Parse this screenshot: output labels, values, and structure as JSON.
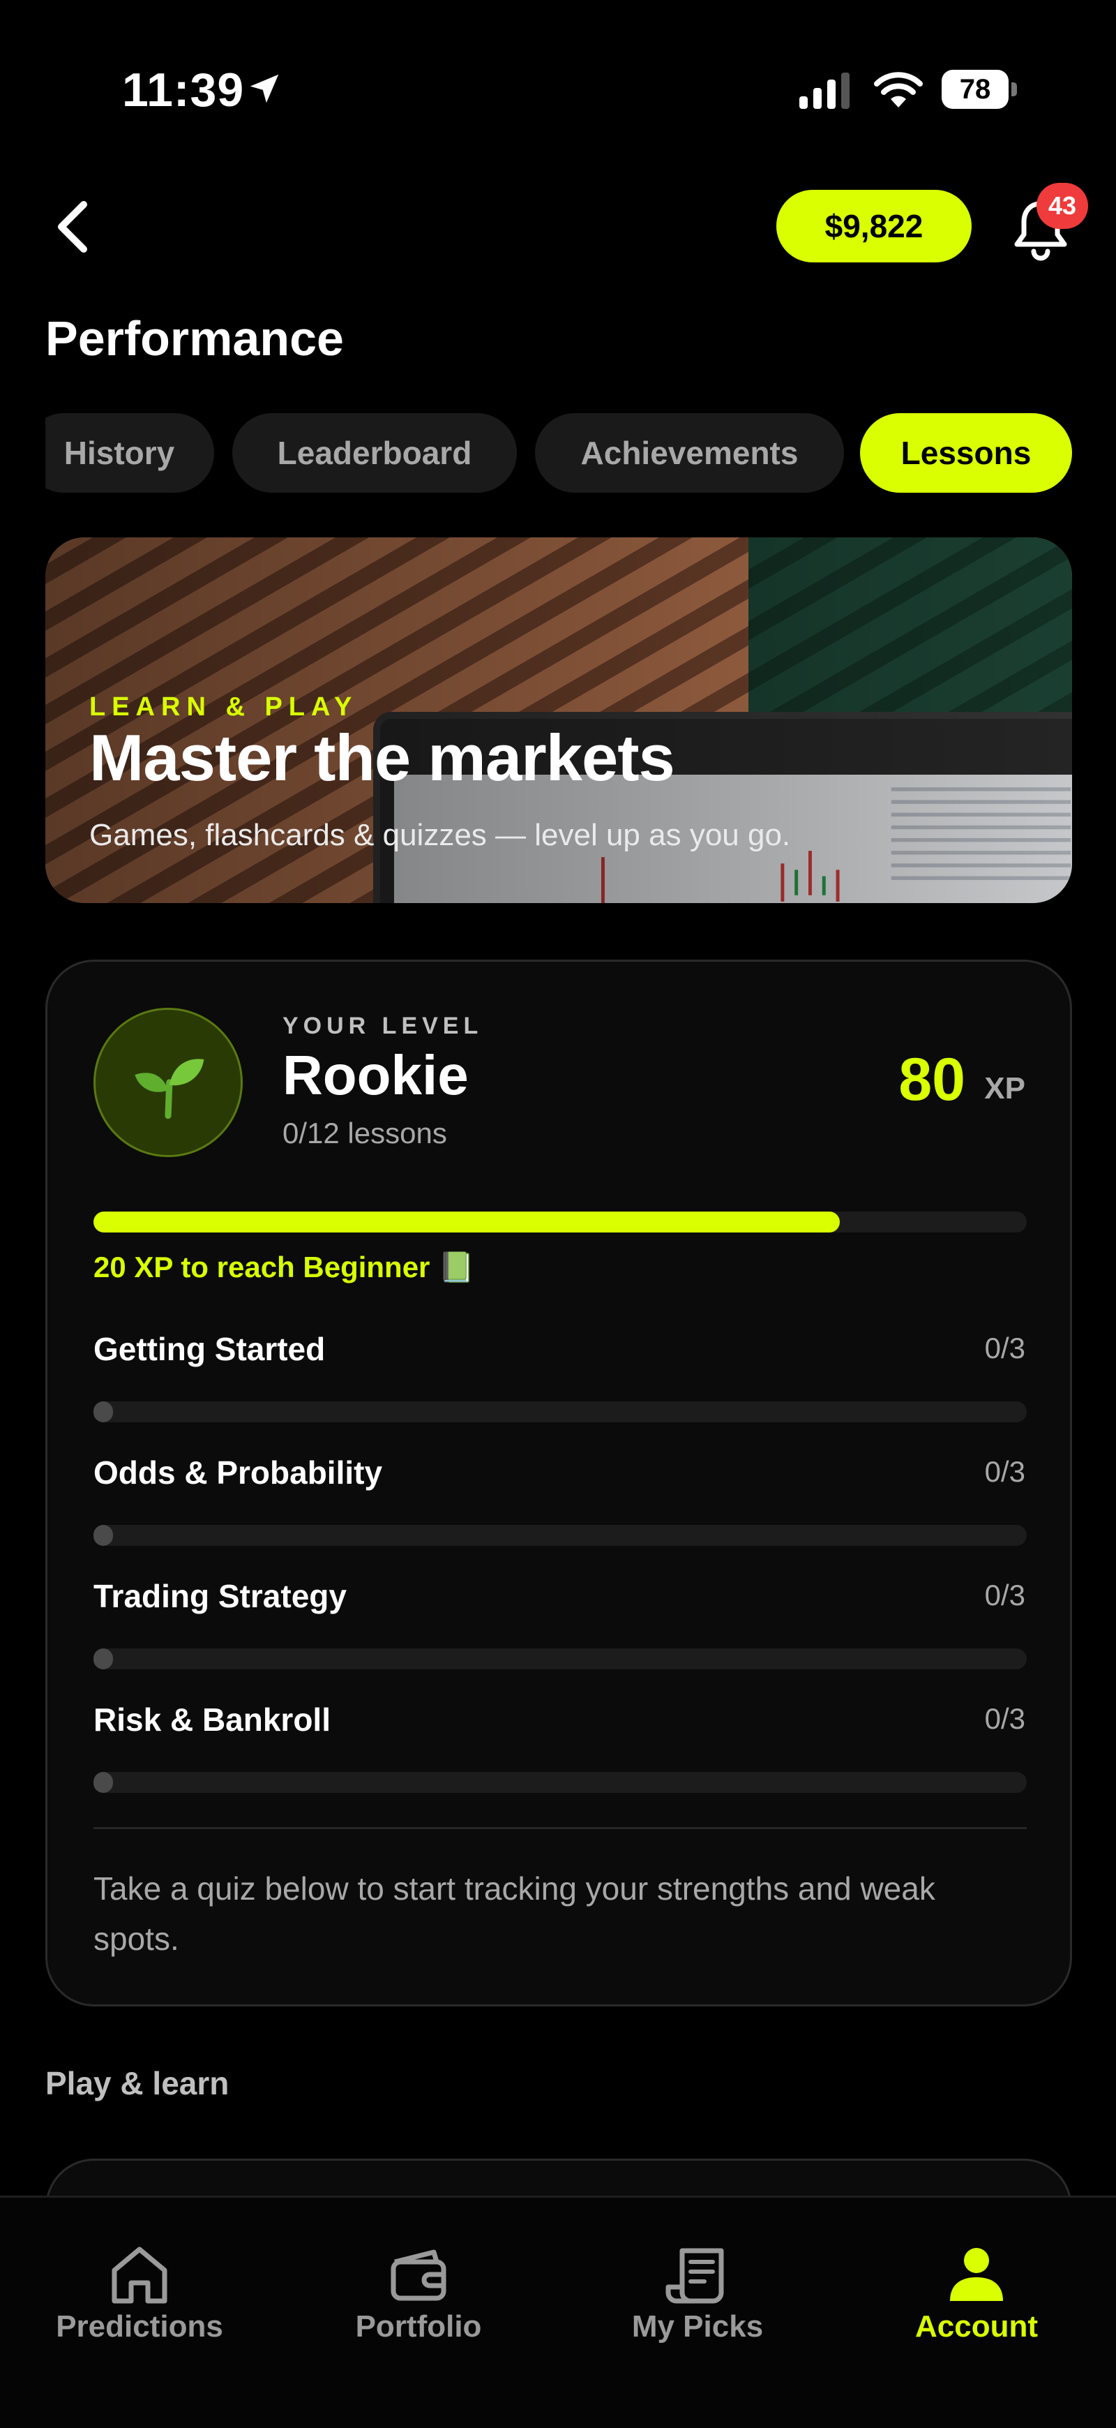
{
  "status_bar": {
    "time": "11:39",
    "battery": "78"
  },
  "header": {
    "balance": "$9,822",
    "notification_count": "43",
    "title": "Performance"
  },
  "tabs": [
    {
      "label": "History",
      "active": false
    },
    {
      "label": "Leaderboard",
      "active": false
    },
    {
      "label": "Achievements",
      "active": false
    },
    {
      "label": "Lessons",
      "active": true
    }
  ],
  "hero": {
    "eyebrow": "LEARN & PLAY",
    "title": "Master the markets",
    "subtitle": "Games, flashcards & quizzes — level up as you go."
  },
  "level": {
    "eyebrow": "YOUR LEVEL",
    "name": "Rookie",
    "lessons": "0/12 lessons",
    "xp": "80",
    "xp_unit": "XP",
    "progress": 0.8,
    "hint": "20 XP to reach Beginner 📗",
    "icon": "seedling-icon"
  },
  "categories": [
    {
      "label": "Getting Started",
      "count": "0/3",
      "progress": 0
    },
    {
      "label": "Odds & Probability",
      "count": "0/3",
      "progress": 0
    },
    {
      "label": "Trading Strategy",
      "count": "0/3",
      "progress": 0
    },
    {
      "label": "Risk & Bankroll",
      "count": "0/3",
      "progress": 0
    }
  ],
  "card_footer": "Take a quiz below to start tracking your strengths and weak spots.",
  "section": {
    "title": "Play & learn"
  },
  "bottom_nav": [
    {
      "label": "Predictions",
      "icon": "home-icon",
      "active": false
    },
    {
      "label": "Portfolio",
      "icon": "wallet-icon",
      "active": false
    },
    {
      "label": "My Picks",
      "icon": "receipt-icon",
      "active": false
    },
    {
      "label": "Account",
      "icon": "user-icon",
      "active": true
    }
  ],
  "colors": {
    "accent": "#d9ff00",
    "background": "#000000",
    "badge": "#ef3b3b"
  }
}
